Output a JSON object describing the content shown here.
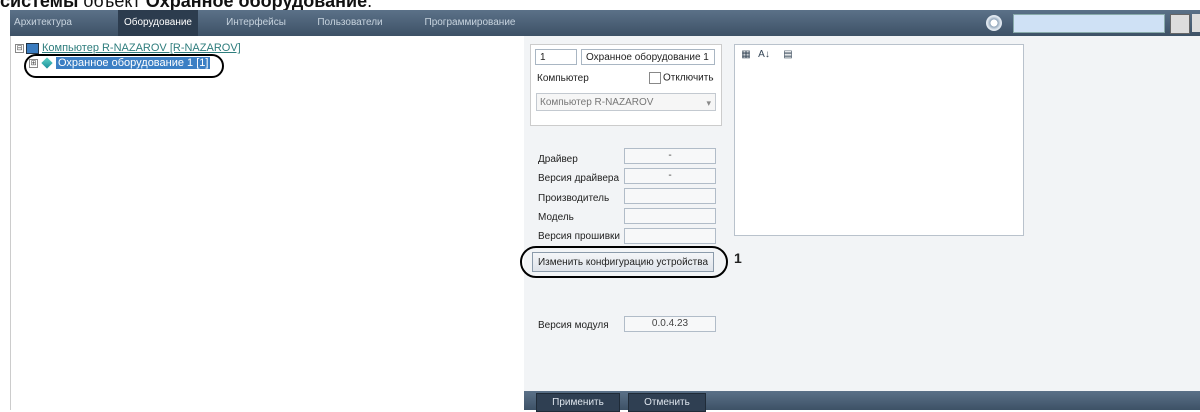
{
  "caption": {
    "bold_start": "системы",
    "normal": " объект ",
    "bold_end": "Охранное оборудование",
    "end": "."
  },
  "tabs": [
    "Архитектура",
    "Оборудование",
    "Интерфейсы",
    "Пользователи",
    "Программирование"
  ],
  "tree": {
    "computer_expander": "⊟",
    "computer_label": "Компьютер R-NAZAROV [R-NAZAROV]",
    "device_expander": "⊞",
    "device_label": "Охранное оборудование 1 [1]"
  },
  "props": {
    "id_value": "1",
    "name_value": "Охранное оборудование 1",
    "computer_label": "Компьютер",
    "disable_label": "Отключить",
    "computer_combo": "Компьютер R-NAZAROV",
    "combo_arrow": "▾"
  },
  "info": {
    "driver_label": "Драйвер",
    "driver_value": "-",
    "driver_version_label": "Версия драйвера",
    "driver_version_value": "-",
    "manufacturer_label": "Производитель",
    "model_label": "Модель",
    "firmware_label": "Версия прошивки",
    "config_button": "Изменить конфигурацию устройства",
    "callout": "1",
    "module_version_label": "Версия модуля",
    "module_version_value": "0.0.4.23"
  },
  "grid_toolbar": {
    "categorized": "▦",
    "sort": "A↓",
    "pages": "▤"
  },
  "footer": {
    "apply": "Применить",
    "cancel": "Отменить"
  },
  "colors": {
    "toolbar": "#4a5f75",
    "active_tab": "#2c3c4e",
    "selection": "#3b7fc4",
    "link": "#2e7d7d"
  }
}
